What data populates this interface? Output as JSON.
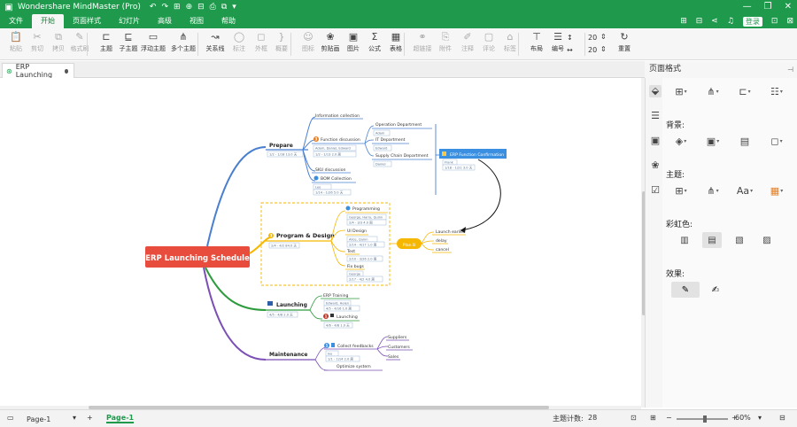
{
  "titlebar": {
    "title": "Wondershare MindMaster (Pro)",
    "quick_access": [
      "↶",
      "↷",
      "⊞",
      "⊕",
      "⊟",
      "⎙",
      "⧉",
      "▾"
    ],
    "window_controls": [
      "—",
      "❐",
      "✕"
    ]
  },
  "menubar": {
    "items": [
      "文件",
      "开始",
      "页面样式",
      "幻灯片",
      "高级",
      "视图",
      "帮助"
    ],
    "active_index": 1,
    "login_label": "登录"
  },
  "toolbar": {
    "items": [
      {
        "label": "粘贴",
        "icon": "paste-icon",
        "glyph": "📋",
        "enabled": false
      },
      {
        "label": "剪切",
        "icon": "cut-icon",
        "glyph": "✂",
        "enabled": false
      },
      {
        "label": "拷贝",
        "icon": "copy-icon",
        "glyph": "⧉",
        "enabled": false
      },
      {
        "label": "格式刷",
        "icon": "format-painter-icon",
        "glyph": "✎",
        "enabled": false
      },
      {
        "label": "主题",
        "icon": "topic-icon",
        "glyph": "⊏",
        "enabled": true
      },
      {
        "label": "子主题",
        "icon": "subtopic-icon",
        "glyph": "⊑",
        "enabled": true
      },
      {
        "label": "浮动主题",
        "icon": "floating-topic-icon",
        "glyph": "▭",
        "enabled": true
      },
      {
        "label": "多个主题",
        "icon": "multiple-topics-icon",
        "glyph": "⋔",
        "enabled": true
      },
      {
        "label": "关系线",
        "icon": "relationship-icon",
        "glyph": "↝",
        "enabled": true
      },
      {
        "label": "标注",
        "icon": "callout-icon",
        "glyph": "◯",
        "enabled": false
      },
      {
        "label": "外框",
        "icon": "boundary-icon",
        "glyph": "◻",
        "enabled": false
      },
      {
        "label": "概要",
        "icon": "summary-icon",
        "glyph": "}",
        "enabled": false
      },
      {
        "label": "图标",
        "icon": "mark-icon",
        "glyph": "☺",
        "enabled": false
      },
      {
        "label": "剪贴画",
        "icon": "clipart-icon",
        "glyph": "❀",
        "enabled": true
      },
      {
        "label": "图片",
        "icon": "picture-icon",
        "glyph": "▣",
        "enabled": true
      },
      {
        "label": "公式",
        "icon": "formula-icon",
        "glyph": "Σ",
        "enabled": true
      },
      {
        "label": "表格",
        "icon": "table-icon",
        "glyph": "▦",
        "enabled": true
      },
      {
        "label": "超链接",
        "icon": "hyperlink-icon",
        "glyph": "⚭",
        "enabled": false
      },
      {
        "label": "附件",
        "icon": "attachment-icon",
        "glyph": "⎘",
        "enabled": false
      },
      {
        "label": "注释",
        "icon": "note-icon",
        "glyph": "✐",
        "enabled": false
      },
      {
        "label": "评论",
        "icon": "comment-icon",
        "glyph": "▢",
        "enabled": false
      },
      {
        "label": "标签",
        "icon": "tag-icon",
        "glyph": "⌂",
        "enabled": false
      },
      {
        "label": "布局",
        "icon": "layout-icon",
        "glyph": "⊤",
        "enabled": true
      },
      {
        "label": "编号",
        "icon": "numbering-icon",
        "glyph": "☰",
        "enabled": true
      },
      {
        "label": "重置",
        "icon": "reset-icon",
        "glyph": "↻",
        "enabled": true
      }
    ],
    "spacing_values": [
      "20",
      "20"
    ]
  },
  "tabs": {
    "document_tab": "ERP Launching"
  },
  "mindmap": {
    "central": "ERP Launching Schedule",
    "central_color": "#e84c3d",
    "branches": [
      {
        "label": "Prepare",
        "color": "#4a7fd0",
        "meta": "1/2 - 1/18  13.0 天",
        "children": [
          {
            "label": "Information collection",
            "meta": "",
            "badge": ""
          },
          {
            "label": "Function discussion",
            "meta": "1/2 - 1/13  2.0 周",
            "badge": "2",
            "badge_color": "#e67e22",
            "owner": "Adam, Daniel, Edward"
          },
          {
            "label": "SKU discussion",
            "meta": "",
            "badge": ""
          },
          {
            "label": "BOM Collection",
            "meta": "1/14 - 1/26  5.0 天",
            "badge": "",
            "owner": "Leo"
          }
        ],
        "grandchildren": [
          {
            "label": "Operation Department",
            "owner": "Adam"
          },
          {
            "label": "IT Department",
            "owner": "Edward"
          },
          {
            "label": "Supply Chain Department",
            "owner": "Daniel"
          }
        ],
        "confirmation": {
          "label": "ERP Function Confirmation",
          "owner": "Frank",
          "meta": "1/18 - 1/21  3.0 天"
        }
      },
      {
        "label": "Program & Design",
        "color": "#f5b700",
        "meta": "2/4 - 4/2  84.0 天",
        "badge": "3",
        "children": [
          {
            "label": "Programming",
            "owner": "George, Harry, Quinn",
            "meta": "2/4 - 3/3  4.0 周"
          },
          {
            "label": "UI Design",
            "owner": "Alice, Quinn",
            "meta": "2/14 - 4/17  1.0 周"
          },
          {
            "label": "Test",
            "meta": "2/10 - 3/26  2.0 周"
          },
          {
            "label": "Fix bugs",
            "owner": "George",
            "meta": "2/17 - 4/2  4.0 周"
          }
        ],
        "plan_b": {
          "label": "Plan B",
          "options": [
            "Launch earlier",
            "delay",
            "cancel"
          ]
        }
      },
      {
        "label": "Launching",
        "color": "#2e9b3e",
        "meta": "4/5 - 4/8  2.0 天",
        "children": [
          {
            "label": "ERP Training",
            "owner": "Edward, Helen",
            "meta": "4/5 - 4/16  1.0 周"
          },
          {
            "label": "Launching",
            "meta": "4/6 - 4/8  1.0 天",
            "badge": "1"
          }
        ]
      },
      {
        "label": "Maintenance",
        "color": "#7b4fb5",
        "meta": "",
        "children": [
          {
            "label": "Collect feedbacks",
            "owner": "Ivy",
            "meta": "1/1 - 12/4  2.0 周",
            "badge": "1"
          },
          {
            "label": "Optimize system",
            "meta": ""
          }
        ],
        "feedback_sources": [
          "Suppliers",
          "Customers",
          "Sales"
        ]
      }
    ]
  },
  "right_panel": {
    "title": "页面格式",
    "background_label": "背景:",
    "theme_label": "主题:",
    "rainbow_label": "彩虹色:",
    "effect_label": "效果:",
    "font_button": "Aa"
  },
  "statusbar": {
    "page_select": "Page-1",
    "page_tab": "Page-1",
    "topic_count_label": "主题计数:",
    "topic_count": "28",
    "zoom": "60%"
  },
  "colors": {
    "accent_green": "#1f9a4c",
    "plan_b_orange": "#f5b700",
    "confirmation_blue": "#3b8fe0"
  }
}
